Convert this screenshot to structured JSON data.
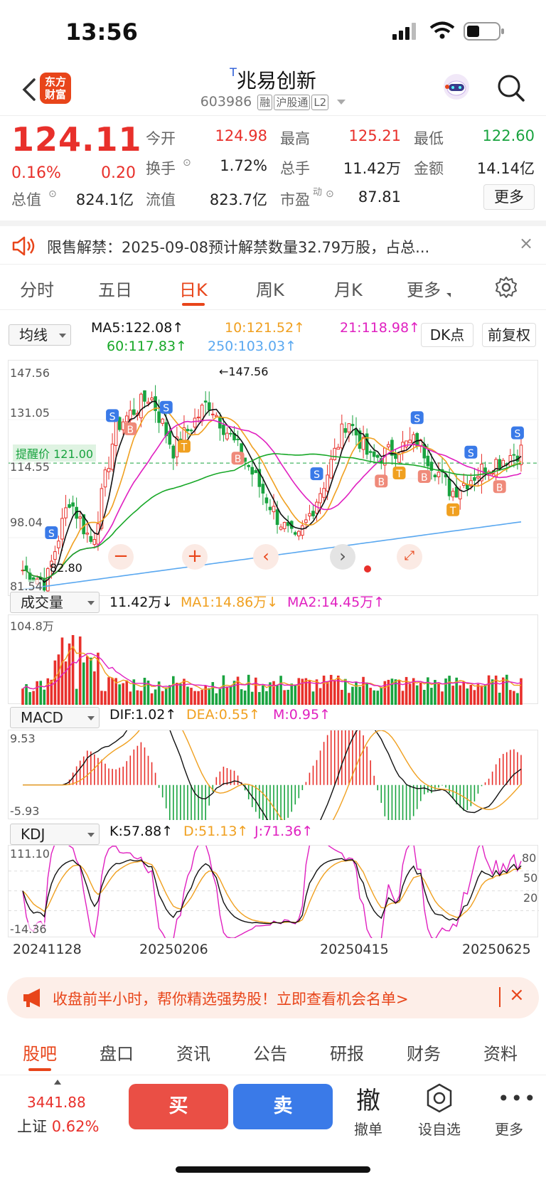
{
  "status": {
    "time": "13:56"
  },
  "header": {
    "logo": "东方财富",
    "title_mark": "T",
    "title": "兆易创新",
    "code": "603986",
    "tags": [
      "融",
      "沪股通",
      "L2"
    ]
  },
  "quote": {
    "price": "124.11",
    "pct": "0.16%",
    "change": "0.20",
    "rows": [
      [
        {
          "label": "今开",
          "value": "124.98",
          "color": "red"
        },
        {
          "label": "最高",
          "value": "125.21",
          "color": "red"
        },
        {
          "label": "最低",
          "value": "122.60",
          "color": "green"
        }
      ],
      [
        {
          "label": "换手",
          "value": "1.72%",
          "color": "blk"
        },
        {
          "label": "总手",
          "value": "11.42万",
          "color": "blk"
        },
        {
          "label": "金额",
          "value": "14.14亿",
          "color": "blk"
        }
      ],
      [
        {
          "label": "总值",
          "value": "824.1亿",
          "color": "blk"
        },
        {
          "label": "流值",
          "value": "823.7亿",
          "color": "blk"
        },
        {
          "label": "市盈",
          "value": "87.81",
          "color": "blk"
        }
      ]
    ],
    "pe_sup": "动",
    "more_label": "更多"
  },
  "notice": {
    "text": "限售解禁：2025-09-08预计解禁数量32.79万股，占总..."
  },
  "tabs": [
    "分时",
    "五日",
    "日K",
    "周K",
    "月K",
    "更多"
  ],
  "active_tab": 2,
  "kline": {
    "selector": "均线",
    "ma5": "MA5:122.08↑",
    "ma10": "10:121.52↑",
    "ma21": "21:118.98↑",
    "ma60": "60:117.83↑",
    "ma250": "250:103.03↑",
    "dk_label": "DK点",
    "fq_label": "前复权",
    "y_ticks": [
      "147.56",
      "131.05",
      "114.55",
      "98.04"
    ],
    "high_label": "←147.56",
    "low_label": "82.80",
    "low_axis": "81.54",
    "alert": "提醒价 121.00"
  },
  "volume": {
    "selector": "成交量",
    "v": "11.42万↓",
    "ma1": "MA1:14.86万↓",
    "ma2": "MA2:14.45万↑",
    "top": "104.8万"
  },
  "macd": {
    "selector": "MACD",
    "dif": "DIF:1.02↑",
    "dea": "DEA:0.55↑",
    "m": "M:0.95↑",
    "top": "9.53",
    "bottom": "-5.93"
  },
  "kdj": {
    "selector": "KDJ",
    "k": "K:57.88↑",
    "d": "D:51.13↑",
    "j": "J:71.36↑",
    "top": "111.10",
    "bottom": "-14.36",
    "levels": [
      "80",
      "50",
      "20"
    ]
  },
  "dates": [
    "20241128",
    "20250206",
    "20250415",
    "20250625"
  ],
  "colors": {
    "up": "#e8302b",
    "down": "#19a33f",
    "ma5": "#111111",
    "ma10": "#f0a020",
    "ma21": "#e020c0",
    "ma60": "#18a828",
    "ma250": "#5aa8f0",
    "brand": "#e8451a"
  },
  "promo": {
    "text": "收盘前半小时，帮你精选强势股！立即查看机会名单>"
  },
  "bottom_tabs": [
    "股吧",
    "盘口",
    "资讯",
    "公告",
    "研报",
    "财务",
    "资料"
  ],
  "index": {
    "value": "3441.88",
    "name": "上证",
    "pct": "0.62%"
  },
  "actions": {
    "buy": "买",
    "sell": "卖",
    "cancel_glyph": "撤",
    "cancel": "撤单",
    "watch": "设自选",
    "more": "更多"
  }
}
